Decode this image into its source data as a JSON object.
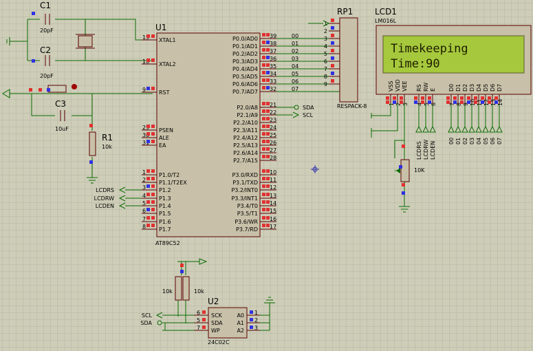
{
  "colors": {
    "background": "#cdcdb8",
    "grid": "#b5b5a2",
    "wire": "#0a6b00",
    "component_body": "#c8c0a8",
    "component_outline": "#5a0000",
    "pin_high": "#e03030",
    "pin_low": "#3030e0",
    "lcd_screen": "#a6c83c"
  },
  "components": {
    "c1": {
      "ref": "C1",
      "value": "20pF"
    },
    "c2": {
      "ref": "C2",
      "value": "20pF"
    },
    "c3": {
      "ref": "C3",
      "value": "10uF"
    },
    "r1": {
      "ref": "R1",
      "value": "10k"
    },
    "u1": {
      "ref": "U1",
      "part": "AT89C52"
    },
    "rp1": {
      "ref": "RP1",
      "part": "RESPACK-8"
    },
    "lcd1": {
      "ref": "LCD1",
      "part": "LM016L",
      "line1": "Timekeeping",
      "line2": "Time:90"
    },
    "pot": {
      "value": "10K"
    },
    "u2": {
      "ref": "U2",
      "part": "24C02C"
    },
    "pullup_left": {
      "value": "10k"
    },
    "pullup_right": {
      "value": "10k"
    }
  },
  "u1_left_pins": [
    {
      "num": "19",
      "name": "XTAL1"
    },
    {
      "num": "18",
      "name": "XTAL2"
    },
    {
      "num": "9",
      "name": "RST"
    },
    {
      "num": "29",
      "name": "PSEN"
    },
    {
      "num": "30",
      "name": "ALE"
    },
    {
      "num": "31",
      "name": "EA"
    },
    {
      "num": "1",
      "name": "P1.0/T2"
    },
    {
      "num": "2",
      "name": "P1.1/T2EX"
    },
    {
      "num": "3",
      "name": "P1.2"
    },
    {
      "num": "4",
      "name": "P1.3"
    },
    {
      "num": "5",
      "name": "P1.4"
    },
    {
      "num": "6",
      "name": "P1.5"
    },
    {
      "num": "7",
      "name": "P1.6"
    },
    {
      "num": "8",
      "name": "P1.7"
    }
  ],
  "u1_right_pins": [
    {
      "num": "39",
      "name": "P0.0/AD0"
    },
    {
      "num": "38",
      "name": "P0.1/AD1"
    },
    {
      "num": "37",
      "name": "P0.2/AD2"
    },
    {
      "num": "36",
      "name": "P0.3/AD3"
    },
    {
      "num": "35",
      "name": "P0.4/AD4"
    },
    {
      "num": "34",
      "name": "P0.5/AD5"
    },
    {
      "num": "33",
      "name": "P0.6/AD6"
    },
    {
      "num": "32",
      "name": "P0.7/AD7"
    },
    {
      "num": "21",
      "name": "P2.0/A8"
    },
    {
      "num": "22",
      "name": "P2.1/A9"
    },
    {
      "num": "23",
      "name": "P2.2/A10"
    },
    {
      "num": "24",
      "name": "P2.3/A11"
    },
    {
      "num": "25",
      "name": "P2.4/A12"
    },
    {
      "num": "26",
      "name": "P2.5/A13"
    },
    {
      "num": "27",
      "name": "P2.6/A14"
    },
    {
      "num": "28",
      "name": "P2.7/A15"
    },
    {
      "num": "10",
      "name": "P3.0/RXD"
    },
    {
      "num": "11",
      "name": "P3.1/TXD"
    },
    {
      "num": "12",
      "name": "P3.2/INT0"
    },
    {
      "num": "13",
      "name": "P3.3/INT1"
    },
    {
      "num": "14",
      "name": "P3.4/T0"
    },
    {
      "num": "15",
      "name": "P3.5/T1"
    },
    {
      "num": "16",
      "name": "P3.6/WR"
    },
    {
      "num": "17",
      "name": "P3.7/RD"
    }
  ],
  "p0_nets": [
    "00",
    "01",
    "02",
    "03",
    "04",
    "05",
    "06",
    "07"
  ],
  "rp1_pins": [
    "1",
    "2",
    "3",
    "4",
    "5",
    "6",
    "7",
    "8",
    "9"
  ],
  "p2_nets": [
    "SDA",
    "SCL"
  ],
  "p1_nets": [
    "LCDRS",
    "LCDRW",
    "LCDEN"
  ],
  "lcd_pins": [
    {
      "num": "1",
      "name": "VSS"
    },
    {
      "num": "2",
      "name": "VDD"
    },
    {
      "num": "3",
      "name": "VEE"
    },
    {
      "num": "4",
      "name": "RS"
    },
    {
      "num": "5",
      "name": "RW"
    },
    {
      "num": "6",
      "name": "E"
    },
    {
      "num": "7",
      "name": "D0"
    },
    {
      "num": "8",
      "name": "D1"
    },
    {
      "num": "9",
      "name": "D2"
    },
    {
      "num": "10",
      "name": "D3"
    },
    {
      "num": "11",
      "name": "D4"
    },
    {
      "num": "12",
      "name": "D5"
    },
    {
      "num": "13",
      "name": "D6"
    },
    {
      "num": "14",
      "name": "D7"
    }
  ],
  "lcd_ctrl_nets": [
    "LCDRS",
    "LCDRW",
    "LCDEN"
  ],
  "lcd_data_nets": [
    "00",
    "01",
    "02",
    "03",
    "04",
    "05",
    "06",
    "07"
  ],
  "u2_left_pins": [
    {
      "num": "6",
      "name": "SCK"
    },
    {
      "num": "5",
      "name": "SDA"
    },
    {
      "num": "7",
      "name": "WP"
    }
  ],
  "u2_right_pins": [
    {
      "num": "1",
      "name": "A0"
    },
    {
      "num": "2",
      "name": "A1"
    },
    {
      "num": "3",
      "name": "A2"
    }
  ],
  "u2_nets": [
    "SCL",
    "SDA"
  ]
}
